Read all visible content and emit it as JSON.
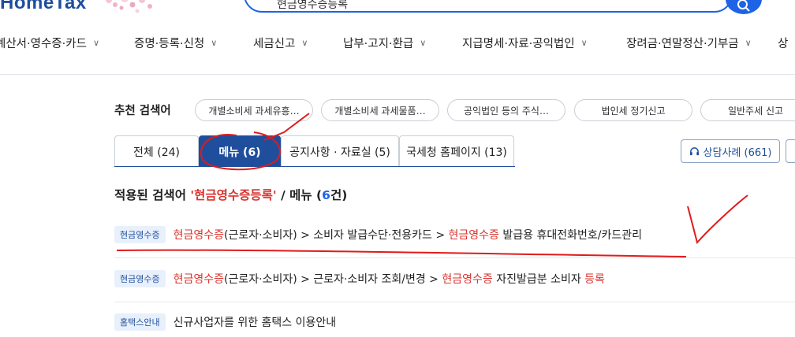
{
  "header": {
    "logo": "HomeTax",
    "search_value": "현금영수증등록"
  },
  "gnb": [
    {
      "label": "계산서·영수증·카드"
    },
    {
      "label": "증명·등록·신청"
    },
    {
      "label": "세금신고"
    },
    {
      "label": "납부·고지·환급"
    },
    {
      "label": "지급명세·자료·공익법인"
    },
    {
      "label": "장려금·연말정산·기부금"
    },
    {
      "label": "상"
    }
  ],
  "recommend": {
    "label": "추천 검색어",
    "chips": [
      "개별소비세 과세유흥…",
      "개별소비세 과세물품…",
      "공익법인 등의 주식…",
      "법인세 정기신고",
      "일반주세 신고"
    ]
  },
  "tabs": [
    {
      "label": "전체 (24)"
    },
    {
      "label": "메뉴 (6)"
    },
    {
      "label": "공지사항 · 자료실 (5)"
    },
    {
      "label": "국세청 홈페이지 (13)"
    }
  ],
  "consult": {
    "label": "상담사례 (661)"
  },
  "applied": {
    "prefix": "적용된 검색어 ",
    "keyword": "'현금영수증등록'",
    "middle": " / 메뉴 (",
    "count": "6",
    "suffix": "건)"
  },
  "results": [
    {
      "badge": "현금영수증",
      "parts": [
        {
          "t": "현금영수증",
          "hl": true
        },
        {
          "t": "(근로자·소비자) > 소비자 발급수단·전용카드 > ",
          "hl": false
        },
        {
          "t": "현금영수증",
          "hl": true
        },
        {
          "t": " 발급용 휴대전화번호/카드관리",
          "hl": false
        }
      ]
    },
    {
      "badge": "현금영수증",
      "parts": [
        {
          "t": "현금영수증",
          "hl": true
        },
        {
          "t": "(근로자·소비자) > 근로자·소비자 조회/변경 > ",
          "hl": false
        },
        {
          "t": "현금영수증",
          "hl": true
        },
        {
          "t": " 자진발급분 소비자 ",
          "hl": false
        },
        {
          "t": "등록",
          "hl": true
        }
      ]
    },
    {
      "badge": "홈택스안내",
      "parts": [
        {
          "t": "신규사업자를 위한 홈택스 이용안내",
          "hl": false
        }
      ]
    }
  ],
  "colors": {
    "brand": "#1f4e9c",
    "accent": "#1e63e6",
    "highlight": "#d9332e",
    "annotation": "#e01b1b"
  }
}
